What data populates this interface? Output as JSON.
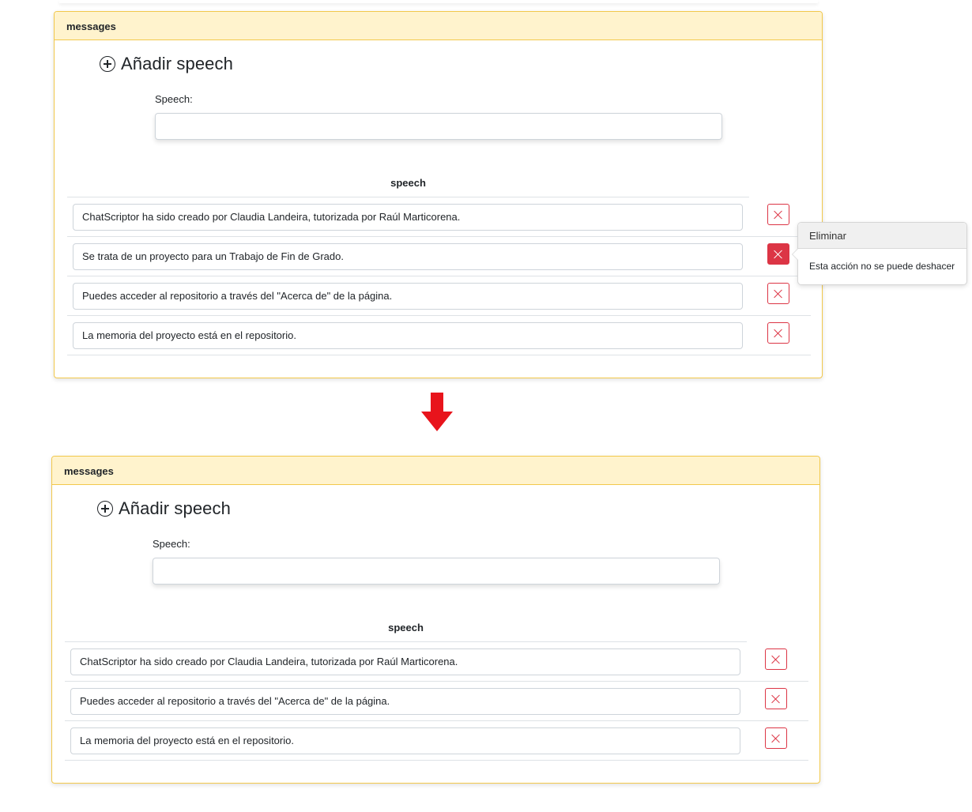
{
  "panels": [
    {
      "header": "messages",
      "add_title": "Añadir speech",
      "speech_label": "Speech:",
      "speech_input_value": "",
      "column_header": "speech",
      "rows": [
        "ChatScriptor ha sido creado por Claudia Landeira, tutorizada por Raúl Marticorena.",
        "Se trata de un proyecto para un Trabajo de Fin de Grado.",
        "Puedes acceder al repositorio a través del \"Acerca de\" de la página.",
        "La memoria del proyecto está en el repositorio."
      ]
    },
    {
      "header": "messages",
      "add_title": "Añadir speech",
      "speech_label": "Speech:",
      "speech_input_value": "",
      "column_header": "speech",
      "rows": [
        "ChatScriptor ha sido creado por Claudia Landeira, tutorizada por Raúl Marticorena.",
        "Puedes acceder al repositorio a través del \"Acerca de\" de la página.",
        "La memoria del proyecto está en el repositorio."
      ]
    }
  ],
  "popover": {
    "title": "Eliminar",
    "body": "Esta acción no se puede deshacer"
  },
  "colors": {
    "card_border": "#f2c84b",
    "card_header_bg": "#fff3cd",
    "danger": "#dc3545",
    "arrow": "#e8141c"
  },
  "icons": {
    "add": "plus-circle-icon",
    "delete": "x-icon",
    "transition": "arrow-down-icon"
  }
}
